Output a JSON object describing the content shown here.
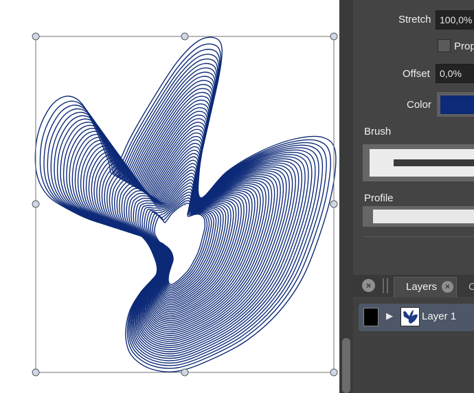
{
  "properties": {
    "stretch_label": "Stretch",
    "stretch_value": "100,0%",
    "proportional_label": "Prop",
    "offset_label": "Offset",
    "offset_value": "0,0%",
    "color_label": "Color",
    "color_value": "#0d2a78",
    "brush_label": "Brush",
    "profile_label": "Profile"
  },
  "layers_panel": {
    "tab_label": "Layers",
    "next_tab_label": "C",
    "layers": [
      {
        "name": "Layer 1",
        "expand_icon": "triangle-right-icon"
      }
    ]
  },
  "canvas": {
    "stroke_color": "#0d2a78",
    "selection_handle_color": "#cdd9e8"
  }
}
